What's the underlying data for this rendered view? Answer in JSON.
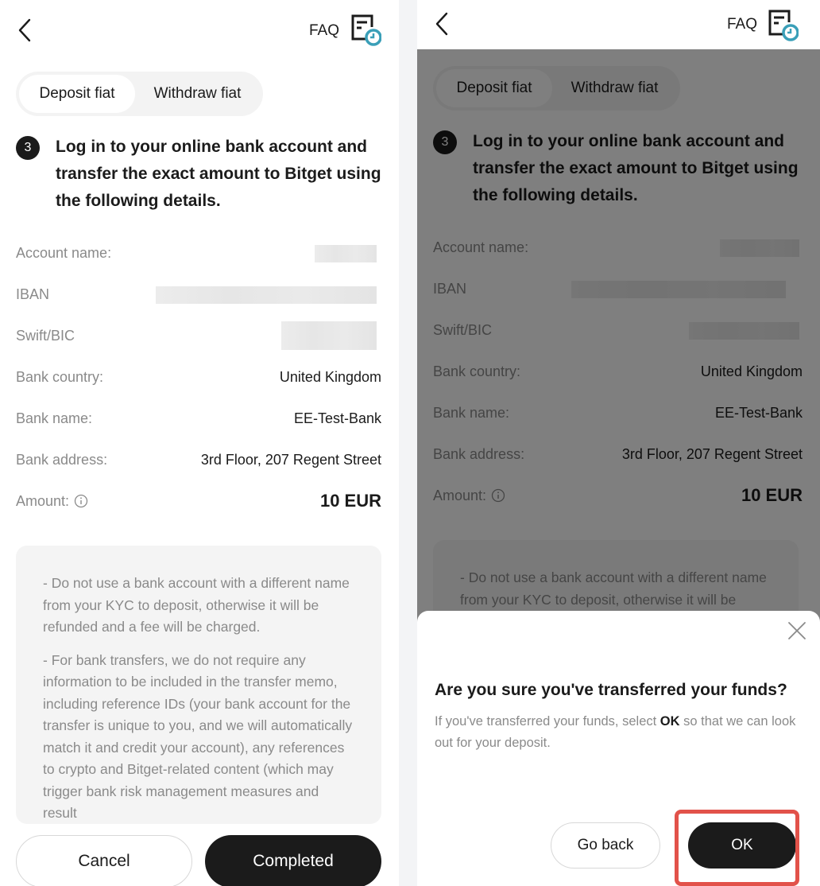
{
  "header": {
    "faq_label": "FAQ"
  },
  "tabs": [
    {
      "label": "Deposit fiat",
      "active": true
    },
    {
      "label": "Withdraw fiat",
      "active": false
    }
  ],
  "step": {
    "number": "3",
    "text": "Log in to your online bank account and transfer the exact amount to Bitget using the following details."
  },
  "details": [
    {
      "label": "Account name:",
      "value": "",
      "redacted": true
    },
    {
      "label": "IBAN",
      "value": "",
      "redacted": true
    },
    {
      "label": "Swift/BIC",
      "value": "",
      "redacted": true
    },
    {
      "label": "Bank country:",
      "value": "United Kingdom"
    },
    {
      "label": "Bank name:",
      "value": "EE-Test-Bank"
    },
    {
      "label": "Bank address:",
      "value": "3rd Floor, 207 Regent Street"
    },
    {
      "label": "Amount:",
      "value": "10 EUR",
      "has_info_icon": true
    }
  ],
  "notice": {
    "paragraphs": [
      "- Do not use a bank account with a different name from your KYC to deposit, otherwise it will be refunded and a fee will be charged.",
      "- For bank transfers, we do not require any information to be included in the transfer memo, including reference IDs (your bank account for the transfer is unique to you, and we will automatically match it and credit your account), any references to crypto and Bitget-related content (which may trigger bank risk management measures and result"
    ]
  },
  "actions": {
    "cancel_label": "Cancel",
    "completed_label": "Completed"
  },
  "dialog": {
    "title": "Are you sure you've transferred your funds?",
    "desc_before": "If you've transferred your funds, select ",
    "desc_bold": "OK",
    "desc_after": " so that we can look out for your deposit.",
    "go_back_label": "Go back",
    "ok_label": "OK"
  },
  "colors": {
    "primary_button": "#1b1b1b",
    "faq_icon_accent": "#3a9fb8",
    "highlight_box": "#e2524a"
  }
}
